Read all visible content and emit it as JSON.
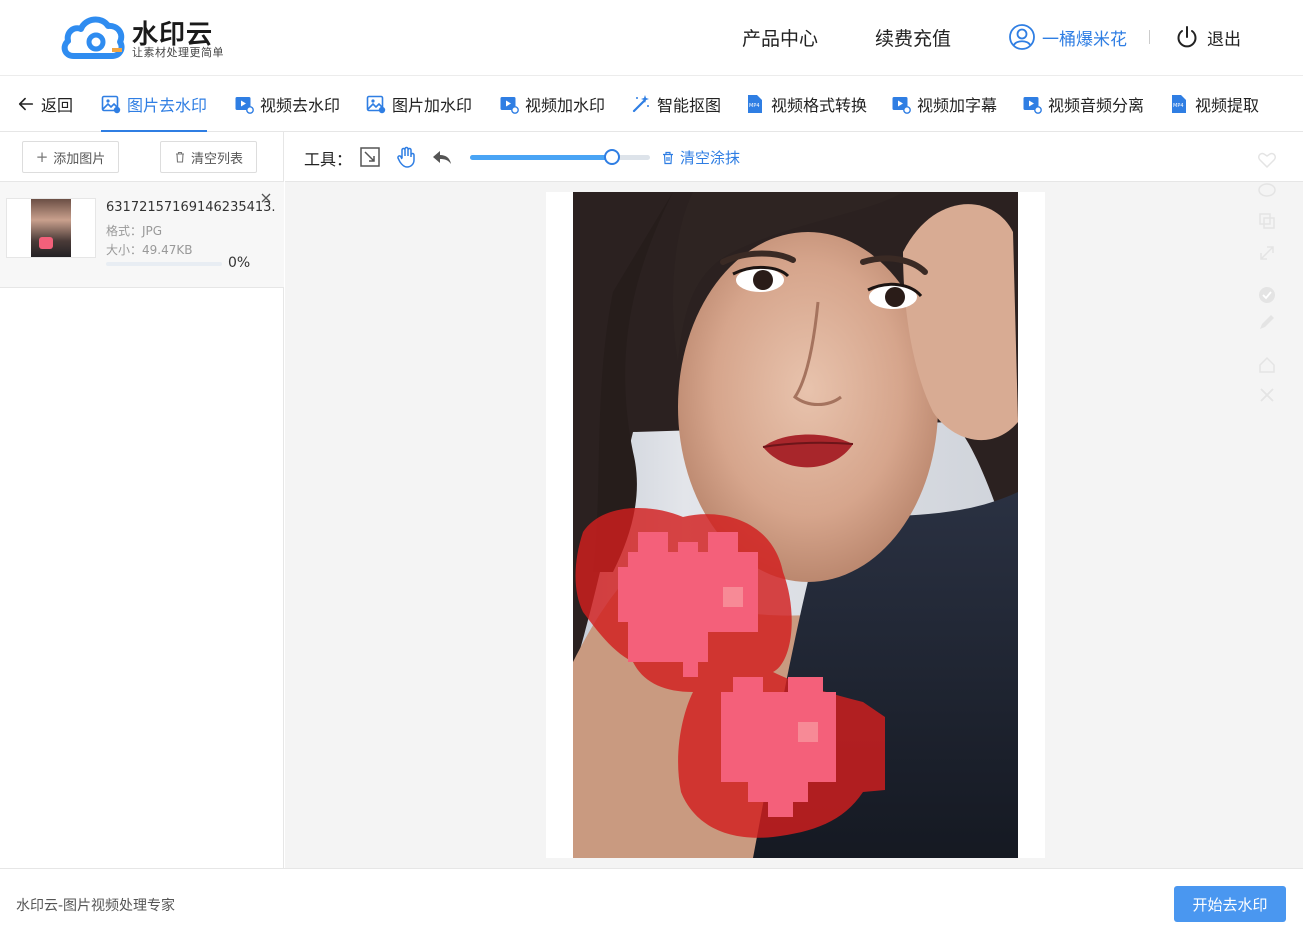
{
  "app": {
    "logo_title": "水印云",
    "logo_subtitle": "让素材处理更简单"
  },
  "topnav": {
    "product_center": "产品中心",
    "renew": "续费充值",
    "username": "一桶爆米花",
    "logout": "退出"
  },
  "tabs": [
    {
      "label": "返回",
      "icon": "arrow-left-icon"
    },
    {
      "label": "图片去水印",
      "icon": "image-icon",
      "active": true
    },
    {
      "label": "视频去水印",
      "icon": "video-icon"
    },
    {
      "label": "图片加水印",
      "icon": "image-icon"
    },
    {
      "label": "视频加水印",
      "icon": "video-icon"
    },
    {
      "label": "智能抠图",
      "icon": "magic-wand-icon"
    },
    {
      "label": "视频格式转换",
      "icon": "mp4-file-icon"
    },
    {
      "label": "视频加字幕",
      "icon": "video-icon"
    },
    {
      "label": "视频音频分离",
      "icon": "video-icon"
    },
    {
      "label": "视频提取",
      "icon": "mp4-file-icon"
    }
  ],
  "sidebar": {
    "add_image": "添加图片",
    "clear_list": "清空列表",
    "file": {
      "name": "63172157169146235413...",
      "format": "格式：JPG",
      "size": "大小：49.47KB",
      "progress_text": "0%",
      "progress": 0
    }
  },
  "toolbar": {
    "label": "工具：",
    "brush_level": 0.79,
    "clear_paint": "清空涂抹"
  },
  "footer": {
    "text": "水印云-图片视频处理专家",
    "start_button": "开始去水印"
  },
  "colors": {
    "accent": "#2f7ee3",
    "button": "#4a97f0",
    "mask_red": "#d21e1e"
  }
}
